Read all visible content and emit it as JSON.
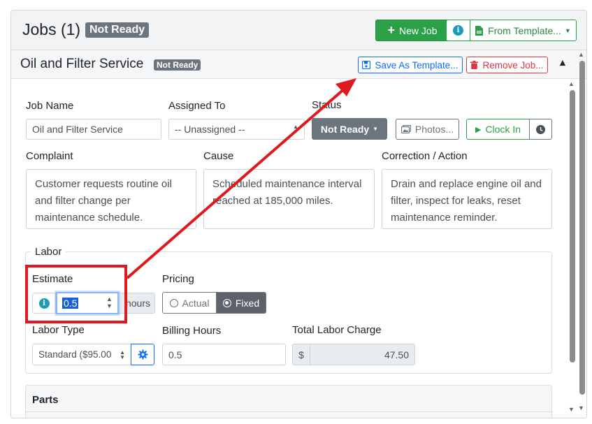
{
  "jobs_header": {
    "title": "Jobs (1)",
    "badge": "Not Ready",
    "new_job_label": "New Job",
    "from_template_label": "From Template..."
  },
  "job": {
    "title": "Oil and Filter Service",
    "badge": "Not Ready",
    "save_template_label": "Save As Template...",
    "remove_label": "Remove Job..."
  },
  "form": {
    "job_name_label": "Job Name",
    "job_name_value": "Oil and Filter Service",
    "assigned_label": "Assigned To",
    "assigned_value": "-- Unassigned --",
    "status_label": "Status",
    "status_value": "Not Ready",
    "photos_label": "Photos...",
    "clock_in_label": "Clock In",
    "complaint_label": "Complaint",
    "complaint_text": "Customer requests routine oil and filter change per maintenance schedule.",
    "cause_label": "Cause",
    "cause_text": "Scheduled maintenance interval reached at 185,000 miles.",
    "correction_label": "Correction / Action",
    "correction_text": "Drain and replace engine oil and filter, inspect for leaks, reset maintenance reminder."
  },
  "labor": {
    "legend": "Labor",
    "estimate_label": "Estimate",
    "estimate_value": "0.5",
    "estimate_suffix": "hours",
    "pricing_label": "Pricing",
    "pricing_actual": "Actual",
    "pricing_fixed": "Fixed",
    "labor_type_label": "Labor Type",
    "labor_type_value": "Standard ($95.00",
    "billing_hours_label": "Billing Hours",
    "billing_hours_value": "0.5",
    "total_label": "Total Labor Charge",
    "currency": "$",
    "total_value": "47.50"
  },
  "parts": {
    "title": "Parts"
  },
  "colors": {
    "success": "#2aa146",
    "primary": "#0d6efd",
    "danger": "#dc3545",
    "secondary": "#6c757d",
    "annotation_red": "#e0191f"
  }
}
